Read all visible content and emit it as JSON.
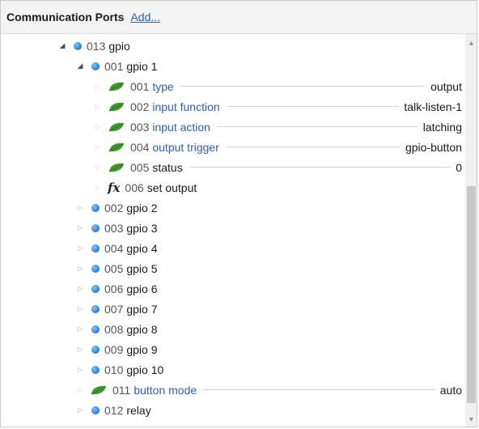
{
  "header": {
    "title": "Communication Ports",
    "add_label": "Add..."
  },
  "tree": {
    "rows": [
      {
        "num": "013",
        "label": "gpio"
      },
      {
        "num": "001",
        "label": "gpio 1"
      },
      {
        "num": "001",
        "label": "type",
        "value": "output"
      },
      {
        "num": "002",
        "label": "input function",
        "value": "talk-listen-1"
      },
      {
        "num": "003",
        "label": "input action",
        "value": "latching"
      },
      {
        "num": "004",
        "label": "output trigger",
        "value": "gpio-button"
      },
      {
        "num": "005",
        "label": "status",
        "value": "0"
      },
      {
        "num": "006",
        "label": "set output"
      },
      {
        "num": "002",
        "label": "gpio 2"
      },
      {
        "num": "003",
        "label": "gpio 3"
      },
      {
        "num": "004",
        "label": "gpio 4"
      },
      {
        "num": "005",
        "label": "gpio 5"
      },
      {
        "num": "006",
        "label": "gpio 6"
      },
      {
        "num": "007",
        "label": "gpio 7"
      },
      {
        "num": "008",
        "label": "gpio 8"
      },
      {
        "num": "009",
        "label": "gpio 9"
      },
      {
        "num": "010",
        "label": "gpio 10"
      },
      {
        "num": "011",
        "label": "button mode",
        "value": "auto"
      },
      {
        "num": "012",
        "label": "relay"
      }
    ]
  },
  "icons": {
    "node": "blue-dot-icon",
    "property": "leaf-icon",
    "function": "fx-icon"
  },
  "colors": {
    "link": "#2f5fb0",
    "node": "#2f86e0",
    "leaf": "#3f9a2e"
  }
}
